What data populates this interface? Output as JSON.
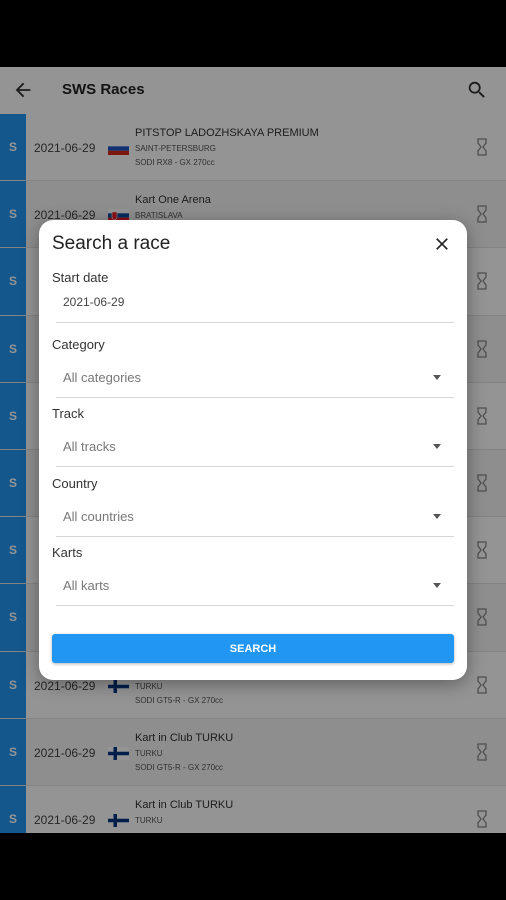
{
  "appbar": {
    "title": "SWS Races",
    "back_icon": "arrow-left-icon",
    "search_icon": "search-icon"
  },
  "colors": {
    "accent": "#2196f3",
    "side_bar": "#2196f3"
  },
  "races": [
    {
      "side": "S",
      "date": "2021-06-29",
      "flag": "russia",
      "name": "PITSTOP LADOZHSKAYA PREMIUM",
      "city": "SAINT-PETERSBURG",
      "kart": "SODI RX8 - GX 270cc"
    },
    {
      "side": "S",
      "date": "2021-06-29",
      "flag": "slovakia",
      "name": "Kart One Arena",
      "city": "BRATISLAVA",
      "kart": ""
    },
    {
      "side": "S",
      "date": "",
      "flag": "",
      "name": "",
      "city": "",
      "kart": ""
    },
    {
      "side": "S",
      "date": "",
      "flag": "",
      "name": "",
      "city": "",
      "kart": ""
    },
    {
      "side": "S",
      "date": "",
      "flag": "",
      "name": "",
      "city": "",
      "kart": ""
    },
    {
      "side": "S",
      "date": "",
      "flag": "",
      "name": "",
      "city": "",
      "kart": ""
    },
    {
      "side": "S",
      "date": "",
      "flag": "",
      "name": "",
      "city": "",
      "kart": ""
    },
    {
      "side": "S",
      "date": "",
      "flag": "",
      "name": "",
      "city": "",
      "kart": ""
    },
    {
      "side": "S",
      "date": "2021-06-29",
      "flag": "finland",
      "name": "",
      "city": "TURKU",
      "kart": "SODI GT5-R - GX 270cc"
    },
    {
      "side": "S",
      "date": "2021-06-29",
      "flag": "finland",
      "name": "Kart in Club TURKU",
      "city": "TURKU",
      "kart": "SODI GT5-R - GX 270cc"
    },
    {
      "side": "S",
      "date": "2021-06-29",
      "flag": "finland",
      "name": "Kart in Club TURKU",
      "city": "TURKU",
      "kart": ""
    }
  ],
  "dialog": {
    "title": "Search a race",
    "close_icon": "close-icon",
    "start_date": {
      "label": "Start date",
      "value": "2021-06-29"
    },
    "category": {
      "label": "Category",
      "value": "All categories"
    },
    "track": {
      "label": "Track",
      "value": "All tracks"
    },
    "country": {
      "label": "Country",
      "value": "All countries"
    },
    "karts": {
      "label": "Karts",
      "value": "All karts"
    },
    "search_button": "SEARCH"
  }
}
